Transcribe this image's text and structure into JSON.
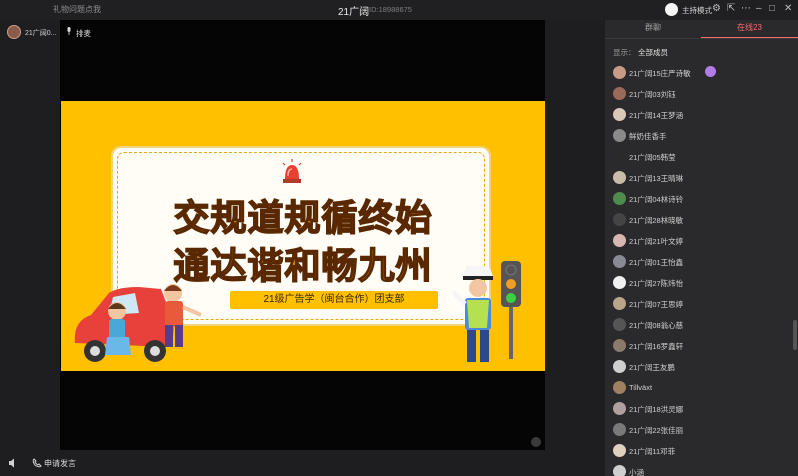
{
  "titlebar": {
    "link": "礼物问题点我",
    "title": "21广阔",
    "id": "ID:18988675",
    "host_mode": "主持模式"
  },
  "left": {
    "user_name": "21广阔0..."
  },
  "stage": {
    "mic_label": "排麦"
  },
  "slide": {
    "title_line1": "交规道规循终始",
    "title_line2": "通达谐和畅九州",
    "subtitle": "21级广告学（闽台合作）团支部"
  },
  "bottom": {
    "apply_speak": "申请发言"
  },
  "panel": {
    "tab_chat": "群聊",
    "tab_online": "在线23",
    "filter_label": "显示：",
    "filter_value": "全部成员"
  },
  "members": [
    {
      "name": "21广阔15庄严诗敏",
      "color": "#c99a86",
      "badge": true
    },
    {
      "name": "21广阔03刘钰",
      "color": "#9a6a5a",
      "badge": false
    },
    {
      "name": "21广阔14王梦涵",
      "color": "#d9c7b8",
      "badge": false
    },
    {
      "name": "鲜奶佳香手",
      "color": "#8a8a8a",
      "badge": false
    },
    {
      "name": "21广阔05韩莹",
      "color": "#2a2a2a",
      "badge": false
    },
    {
      "name": "21广阔13王晴琳",
      "color": "#c8bca8",
      "badge": false
    },
    {
      "name": "21广阔04林诗铃",
      "color": "#4f8a4f",
      "badge": false
    },
    {
      "name": "21广阔28林晓敏",
      "color": "#444444",
      "badge": false
    },
    {
      "name": "21广阔21叶文婷",
      "color": "#d7b8b0",
      "badge": false
    },
    {
      "name": "21广阔01王怡鑫",
      "color": "#8a8a92",
      "badge": false
    },
    {
      "name": "21广阔27陈炜怡",
      "color": "#f0f0f0",
      "badge": false
    },
    {
      "name": "21广阔07王思婷",
      "color": "#b9a58a",
      "badge": false
    },
    {
      "name": "21广阔08翁心慈",
      "color": "#555555",
      "badge": false
    },
    {
      "name": "21广阔16罗鑫轩",
      "color": "#8c7a6a",
      "badge": false
    },
    {
      "name": "21广阔王友鹏",
      "color": "#cfcfcf",
      "badge": false
    },
    {
      "name": "Tillväxt",
      "color": "#a08060",
      "badge": false
    },
    {
      "name": "21广阔18洪灵娜",
      "color": "#b0a0a0",
      "badge": false
    },
    {
      "name": "21广阔22张佳丽",
      "color": "#7a7a7a",
      "badge": false
    },
    {
      "name": "21广阔11邓菲",
      "color": "#e0d0c0",
      "badge": false
    },
    {
      "name": "小涵",
      "color": "#cfcfcf",
      "badge": false
    }
  ]
}
